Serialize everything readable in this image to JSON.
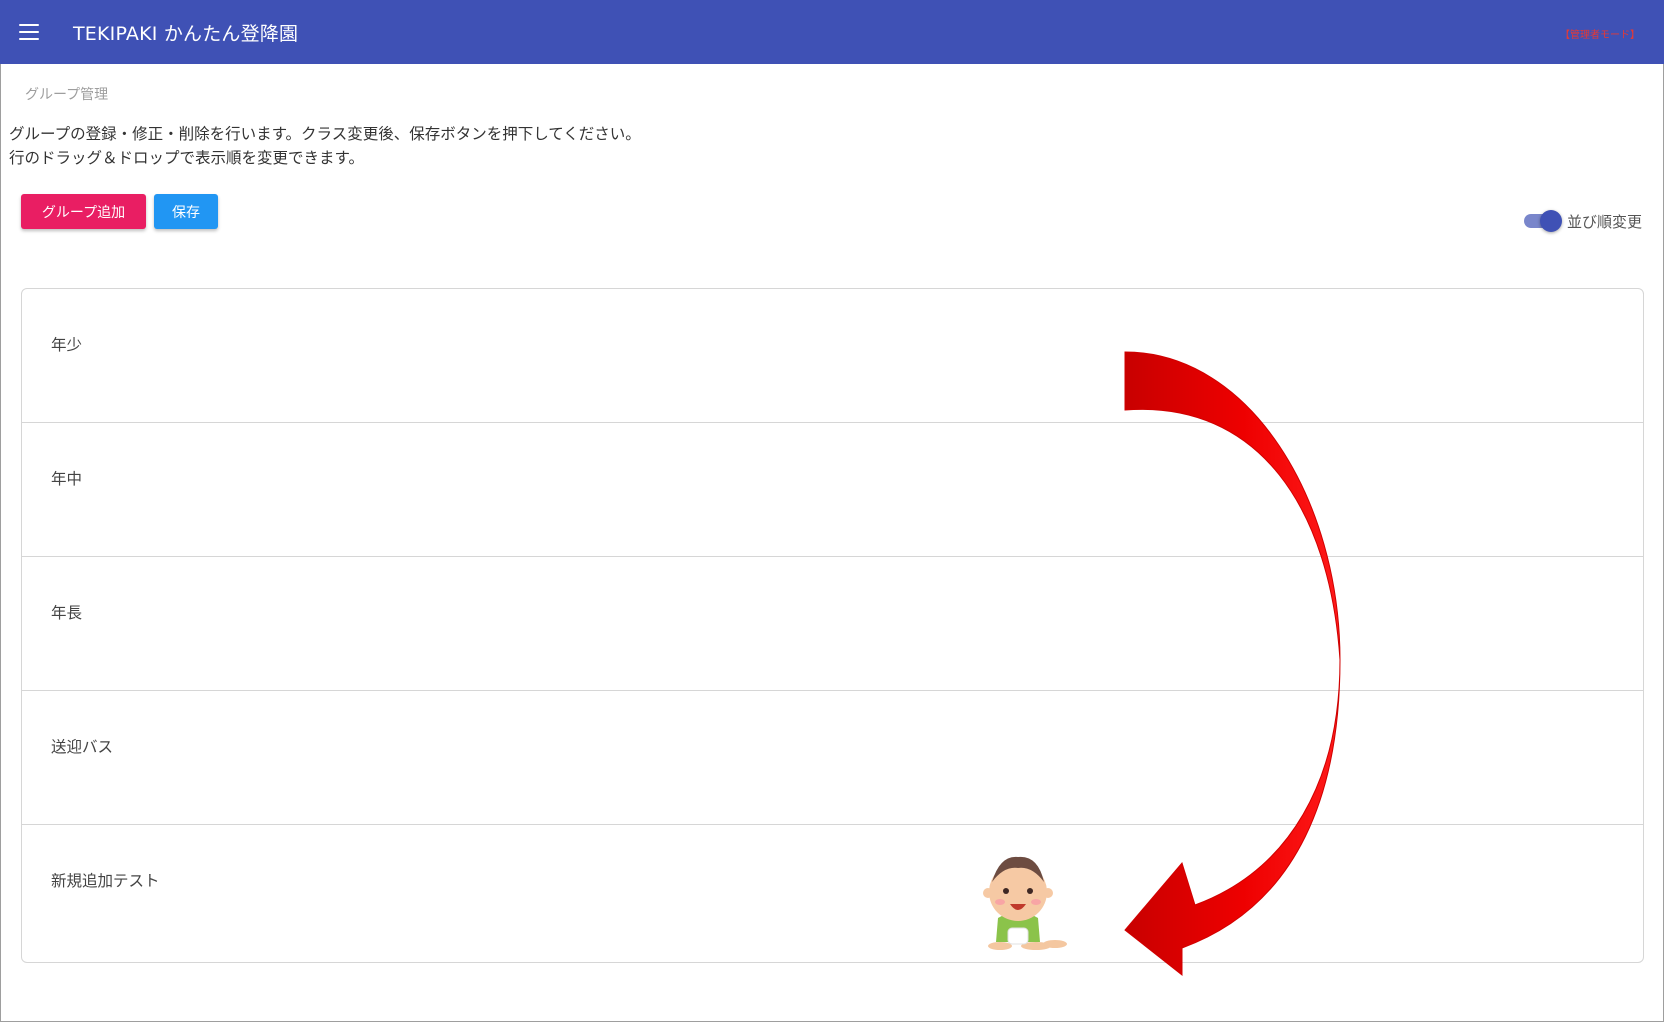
{
  "appbar": {
    "title": "TEKIPAKI かんたん登降園",
    "mode_badge": "【管理者モード】",
    "menu_icon": "hamburger-menu-icon",
    "color": "#3f51b5"
  },
  "breadcrumb": "グループ管理",
  "description": {
    "line1": "グループの登録・修正・削除を行います。クラス変更後、保存ボタンを押下してください。",
    "line2": "行のドラッグ＆ドロップで表示順を変更できます。"
  },
  "toolbar": {
    "add_label": "グループ追加",
    "save_label": "保存",
    "add_color": "#e91e63",
    "save_color": "#2196f3"
  },
  "sort_toggle": {
    "label": "並び順変更",
    "on": true
  },
  "groups": [
    {
      "label": "年少"
    },
    {
      "label": "年中"
    },
    {
      "label": "年長"
    },
    {
      "label": "送迎バス"
    },
    {
      "label": "新規追加テスト"
    }
  ],
  "annotation": {
    "arrow_color": "#ff0000",
    "arrow_icon": "curved-arrow-icon",
    "mascot_icon": "baby-illustration-icon"
  }
}
